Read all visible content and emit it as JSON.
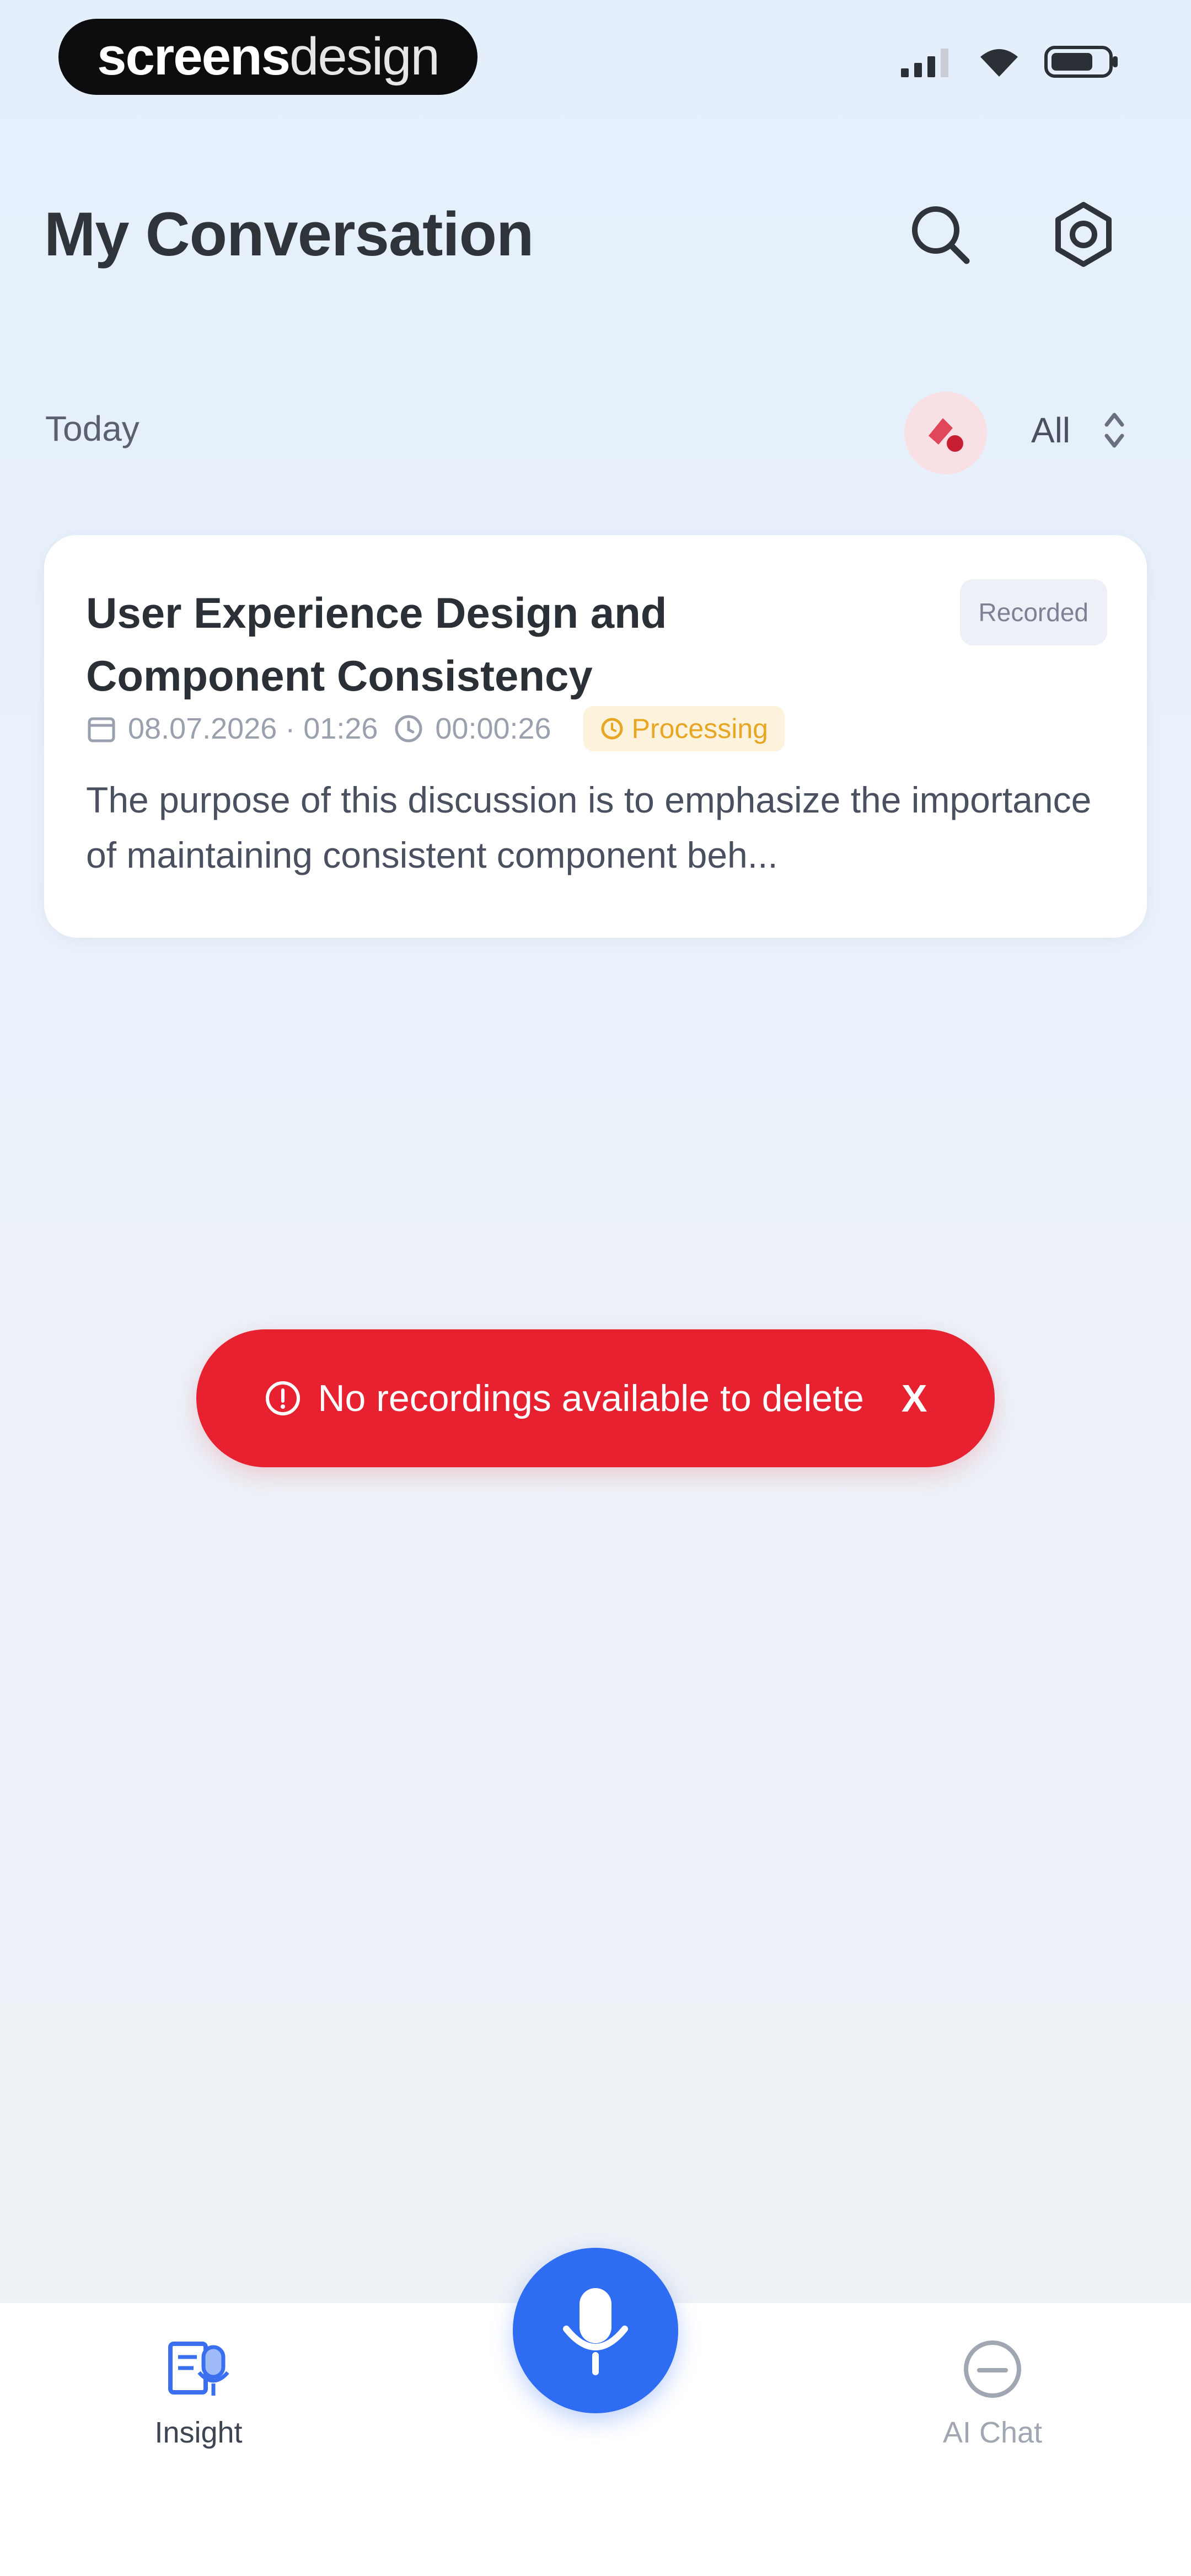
{
  "status_bar": {
    "brand_part1": "screens",
    "brand_part2": "design",
    "icons": [
      "signal-icon",
      "wifi-icon",
      "battery-icon"
    ]
  },
  "header": {
    "title": "My Conversation",
    "search_icon": "search-icon",
    "settings_icon": "gear-icon"
  },
  "section": {
    "label": "Today",
    "delete_icon": "delete-recording-icon",
    "filter_value": "All"
  },
  "conversation": {
    "title": "User Experience Design and Component Consistency",
    "badge": "Recorded",
    "date": "08.07.2026 · 01:26",
    "duration": "00:00:26",
    "status": "Processing",
    "summary": "The purpose of this discussion is to emphasize the importance of maintaining consistent component beh..."
  },
  "toast": {
    "message": "No recordings available to delete",
    "close_label": "X"
  },
  "bottom_nav": {
    "insight_label": "Insight",
    "aichat_label": "AI Chat",
    "record_icon": "microphone-icon"
  },
  "colors": {
    "accent": "#2e6cf2",
    "toast_bg": "#e82131",
    "processing": "#e7a624",
    "delete_bg": "#f8e0e4"
  }
}
